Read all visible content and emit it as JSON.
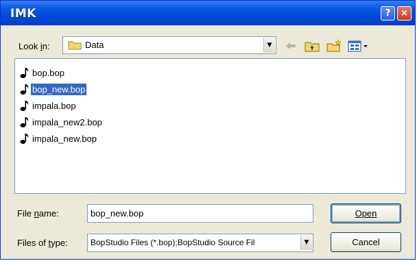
{
  "window": {
    "title": "IMK"
  },
  "titlebar": {
    "help_label": "?",
    "close_label": "×"
  },
  "lookin": {
    "label": "Look in:",
    "value": "Data",
    "arrow": "▼"
  },
  "toolbar": {
    "icons": [
      "back-arrow-icon",
      "up-folder-icon",
      "new-folder-icon",
      "views-menu-icon"
    ]
  },
  "files": [
    {
      "name": "bop.bop",
      "selected": false
    },
    {
      "name": "bop_new.bop",
      "selected": true
    },
    {
      "name": "impala.bop",
      "selected": false
    },
    {
      "name": "impala_new2.bop",
      "selected": false
    },
    {
      "name": "impala_new.bop",
      "selected": false
    }
  ],
  "filename": {
    "label": "File name:",
    "value": "bop_new.bop"
  },
  "filetype": {
    "label": "Files of type:",
    "value": "BopStudio Files (*.bop);BopStudio Source Fil",
    "arrow": "▼"
  },
  "buttons": {
    "open": "Open",
    "cancel": "Cancel"
  },
  "colors": {
    "selection": "#316ac5",
    "title_bar": "#0a5be6"
  }
}
